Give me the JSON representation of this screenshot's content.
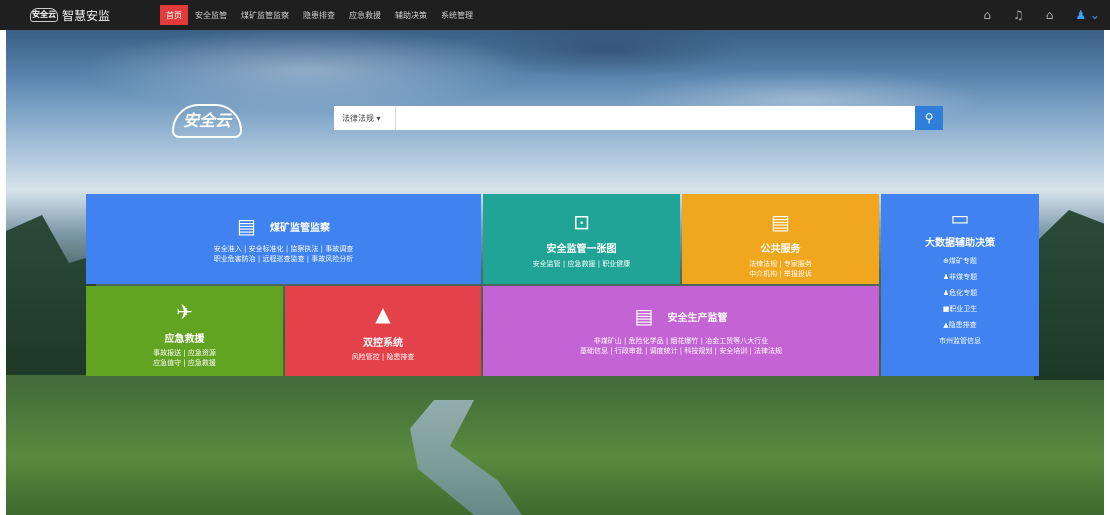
{
  "brand": {
    "logo_text": "安全云",
    "name": "智慧安监"
  },
  "nav": [
    "首页",
    "安全监管",
    "煤矿监管监察",
    "隐患排查",
    "应急救援",
    "辅助决策",
    "系统管理"
  ],
  "search": {
    "select_label": "法律法规 ▾",
    "placeholder": ""
  },
  "hero_logo": "安全云",
  "tiles": {
    "coal": {
      "title": "煤矿监管监察",
      "line1": "安全准入 | 安全标准化 | 监察执法 | 事故调查",
      "line2": "职业危害防治 | 远程巡查监查 | 事故风险分析"
    },
    "safety_map": {
      "title": "安全监管一张图",
      "line1": "安全监管 | 应急救援 | 职业健康"
    },
    "public": {
      "title": "公共服务",
      "line1": "法律法规 | 专家服务",
      "line2": "中介机构 | 举报投诉"
    },
    "bigdata": {
      "title": "大数据辅助决策",
      "items": [
        "⊕煤矿专题",
        "♟非煤专题",
        "♟危化专题",
        "■职业卫生",
        "▲隐患排查",
        "市州监管信息"
      ]
    },
    "emergency": {
      "title": "应急救援",
      "line1": "事故报送 | 应急资源",
      "line2": "应急值守 | 应急救援"
    },
    "dual": {
      "title": "双控系统",
      "line1": "风险管控 | 隐患排查"
    },
    "production": {
      "title": "安全生产监管",
      "line1": "非煤矿山 | 危险化学品 | 烟花爆竹 | 冶金工贸等八大行业",
      "line2": "基础信息 | 行政审批 | 调度统计 | 科技规划 | 安全培训 | 法律法规"
    }
  }
}
